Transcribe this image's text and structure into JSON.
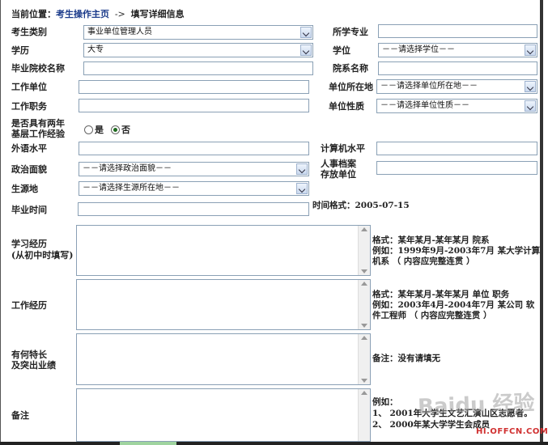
{
  "breadcrumb": {
    "prefix": "当前位置：",
    "home": "考生操作主页",
    "arrow": "->",
    "current": "填写详细信息"
  },
  "fields": {
    "category_label": "考生类别",
    "category_value": "事业单位管理人员",
    "major_label": "所学专业",
    "education_label": "学历",
    "education_value": "大专",
    "degree_label": "学位",
    "degree_value": "－－请选择学位－－",
    "school_label": "毕业院校名称",
    "department_label": "院系名称",
    "employer_label": "工作单位",
    "employer_location_label": "单位所在地",
    "employer_location_value": "－－请选择单位所在地－－",
    "job_title_label": "工作职务",
    "employer_type_label": "单位性质",
    "employer_type_value": "－－请选择单位性质－－",
    "grassroots_label_1": "是否具有两年",
    "grassroots_label_2": "基层工作经验",
    "radio_yes": "是",
    "radio_no": "否",
    "foreign_lang_label": "外语水平",
    "computer_label": "计算机水平",
    "political_label": "政治面貌",
    "political_value": "－－请选择政治面貌－－",
    "archive_label_1": "人事档案",
    "archive_label_2": "存放单位",
    "origin_label": "生源地",
    "origin_value": "－－请选择生源所在地－－",
    "grad_time_label": "毕业时间",
    "time_format": "时间格式：2005-07-15"
  },
  "sections": {
    "study_label_1": "学习经历",
    "study_label_2": "(从初中时填写)",
    "study_note_1": "格式：某年某月-某年某月  院系",
    "study_note_2": "例如：1999年9月-2003年7月  某大学计算",
    "study_note_3": "机系 （ 内容应完整连贯 ）",
    "work_label": "工作经历",
    "work_note_1": "格式：某年某月-某年某月  单位  职务",
    "work_note_2": "例如：2003年4月-2004年7月  某公司  软",
    "work_note_3": "件工程师 （ 内容应完整连贯 ）",
    "skills_label_1": "有何特长",
    "skills_label_2": "及突出业绩",
    "skills_note": "备注：没有请填无",
    "remarks_label": "备注",
    "remarks_note_1": "例如：",
    "remarks_note_2": "1、 2001年大学生文艺汇演山区志愿者。",
    "remarks_note_3": "2、 2000年某大学学生会成员"
  },
  "watermark": {
    "text": "Baidu 经验",
    "site": "HI.OFFCN.COM"
  }
}
